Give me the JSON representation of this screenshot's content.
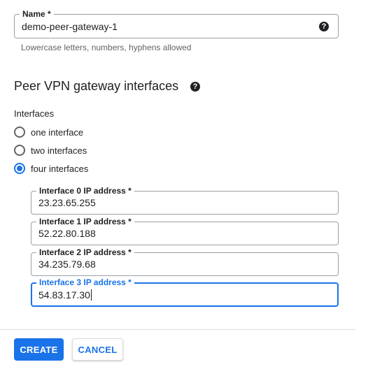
{
  "name_field": {
    "label": "Name *",
    "value": "demo-peer-gateway-1",
    "help_icon": "help-icon",
    "hint": "Lowercase letters, numbers, hyphens allowed"
  },
  "section": {
    "title": "Peer VPN gateway interfaces",
    "help_icon": "help-icon"
  },
  "interfaces": {
    "label": "Interfaces",
    "options": [
      {
        "label": "one interface",
        "checked": false
      },
      {
        "label": "two interfaces",
        "checked": false
      },
      {
        "label": "four interfaces",
        "checked": true
      }
    ]
  },
  "ip_fields": [
    {
      "label": "Interface 0 IP address *",
      "value": "23.23.65.255"
    },
    {
      "label": "Interface 1 IP address *",
      "value": "52.22.80.188"
    },
    {
      "label": "Interface 2 IP address *",
      "value": "34.235.79.68"
    },
    {
      "label": "Interface 3 IP address *",
      "value": "54.83.17.30",
      "focused": true
    }
  ],
  "actions": {
    "create_label": "CREATE",
    "cancel_label": "CANCEL"
  },
  "colors": {
    "accent": "#1a73e8",
    "border": "#9aa0a6",
    "text": "#202124",
    "hint": "#5f6368"
  }
}
